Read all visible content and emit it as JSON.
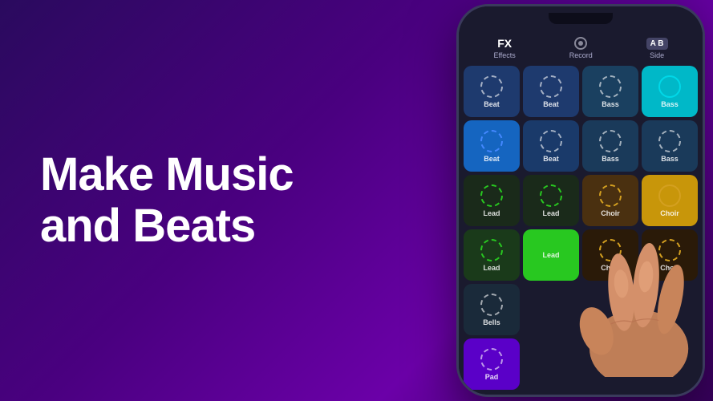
{
  "left": {
    "headline_line1": "Make Music",
    "headline_line2": "and Beats"
  },
  "toolbar": {
    "fx_label": "FX",
    "effects_label": "Effects",
    "record_label": "Record",
    "side_label": "Side",
    "ab_label": "A B"
  },
  "grid": {
    "rows": [
      [
        {
          "label": "Beat",
          "color": "beat-dark",
          "ring": "white"
        },
        {
          "label": "Beat",
          "color": "beat-dark",
          "ring": "white"
        },
        {
          "label": "Bass",
          "color": "bass-dark",
          "ring": "white"
        },
        {
          "label": "Bass",
          "color": "bass-active",
          "ring": "teal",
          "active": true
        }
      ],
      [
        {
          "label": "Beat",
          "color": "beat-active",
          "ring": "blue",
          "active": true
        },
        {
          "label": "Beat",
          "color": "beat-mid",
          "ring": "white"
        },
        {
          "label": "Bass",
          "color": "bass-mid",
          "ring": "white"
        },
        {
          "label": "Bass",
          "color": "bass-mid",
          "ring": "white"
        }
      ],
      [
        {
          "label": "Lead",
          "color": "lead-dark",
          "ring": "green"
        },
        {
          "label": "Lead",
          "color": "lead-dark",
          "ring": "green"
        },
        {
          "label": "Choir",
          "color": "choir-brown",
          "ring": "gold"
        },
        {
          "label": "Choir",
          "color": "choir-gold",
          "ring": "gold",
          "active": true
        }
      ],
      [
        {
          "label": "Lead",
          "color": "lead-green",
          "ring": "green"
        },
        {
          "label": "Lead",
          "color": "green-active",
          "ring": "green",
          "active": true
        },
        {
          "label": "Choir",
          "color": "choir-dark",
          "ring": "gold"
        },
        {
          "label": "Choir",
          "color": "choir-dark",
          "ring": "gold"
        }
      ],
      [
        {
          "label": "Bells",
          "color": "bells",
          "ring": "white"
        },
        {
          "label": "",
          "color": "hidden",
          "ring": "none"
        },
        {
          "label": "",
          "color": "hidden",
          "ring": "none"
        },
        {
          "label": "",
          "color": "hidden",
          "ring": "none"
        }
      ],
      [
        {
          "label": "Pad",
          "color": "pad-purple",
          "ring": "white"
        },
        {
          "label": "",
          "color": "hidden",
          "ring": "none"
        },
        {
          "label": "",
          "color": "hidden",
          "ring": "none"
        },
        {
          "label": "",
          "color": "hidden",
          "ring": "none"
        }
      ]
    ]
  }
}
